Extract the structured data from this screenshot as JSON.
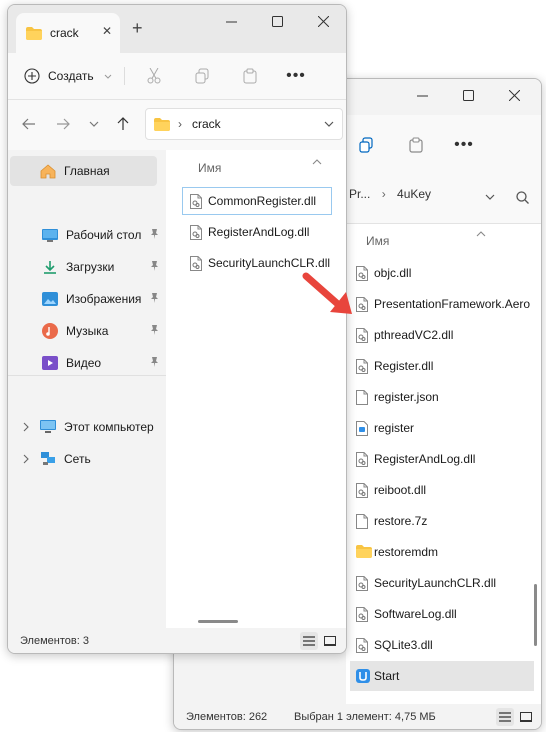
{
  "back": {
    "breadcrumb": {
      "part1": "Pr...",
      "part2": "4uKey"
    },
    "column_header": "Имя",
    "files": [
      {
        "name": "objc.dll",
        "icon": "dll-icon"
      },
      {
        "name": "PresentationFramework.Aero",
        "icon": "dll-icon"
      },
      {
        "name": "pthreadVC2.dll",
        "icon": "dll-icon"
      },
      {
        "name": "Register.dll",
        "icon": "dll-icon"
      },
      {
        "name": "register.json",
        "icon": "text-file-icon"
      },
      {
        "name": "register",
        "icon": "app-icon"
      },
      {
        "name": "RegisterAndLog.dll",
        "icon": "dll-icon"
      },
      {
        "name": "reiboot.dll",
        "icon": "dll-icon"
      },
      {
        "name": "restore.7z",
        "icon": "file-icon"
      },
      {
        "name": "restoremdm",
        "icon": "folder-icon"
      },
      {
        "name": "SecurityLaunchCLR.dll",
        "icon": "dll-icon"
      },
      {
        "name": "SoftwareLog.dll",
        "icon": "dll-icon"
      },
      {
        "name": "SQLite3.dll",
        "icon": "dll-icon"
      },
      {
        "name": "Start",
        "icon": "start-app-icon"
      }
    ],
    "status": {
      "count": "Элементов: 262",
      "selected": "Выбран 1 элемент: 4,75 МБ"
    }
  },
  "front": {
    "tab_title": "crack",
    "new_button": "Создать",
    "address": "crack",
    "column_header": "Имя",
    "sidebar": {
      "home": "Главная",
      "quick": [
        {
          "label": "Рабочий стол",
          "icon": "desktop-icon"
        },
        {
          "label": "Загрузки",
          "icon": "download-icon"
        },
        {
          "label": "Изображения",
          "icon": "pictures-icon"
        },
        {
          "label": "Музыка",
          "icon": "music-icon"
        },
        {
          "label": "Видео",
          "icon": "video-icon"
        }
      ],
      "computer": "Этот компьютер",
      "network": "Сеть"
    },
    "files": [
      {
        "name": "CommonRegister.dll"
      },
      {
        "name": "RegisterAndLog.dll"
      },
      {
        "name": "SecurityLaunchCLR.dll"
      }
    ],
    "status": {
      "count": "Элементов: 3"
    }
  },
  "colors": {
    "accent": "#0067c0",
    "arrow": "#e8453c",
    "selected_row": "#e5e5e5",
    "selection_border": "#99c9ef"
  }
}
